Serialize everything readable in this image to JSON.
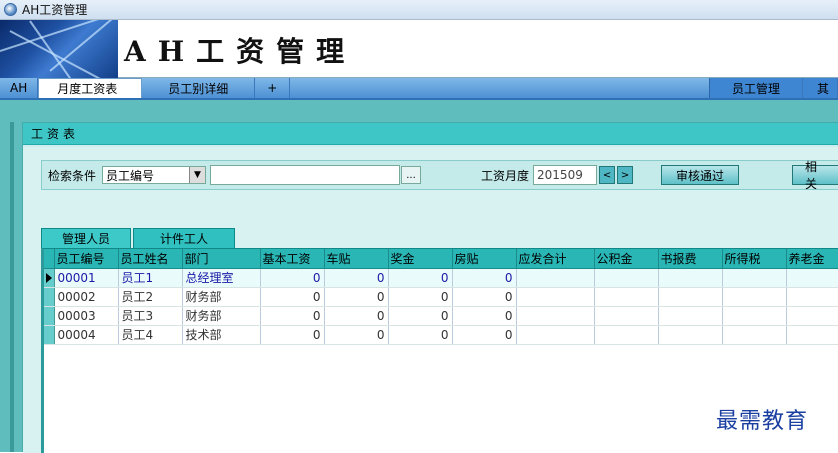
{
  "window": {
    "title": "AH工资管理"
  },
  "banner": {
    "title": "AH工资管理"
  },
  "menubar": {
    "tabs": [
      "AH",
      "月度工资表",
      "员工别详细",
      "+"
    ],
    "right_tabs": [
      "员工管理",
      "其"
    ]
  },
  "panel": {
    "header": "工资表"
  },
  "search": {
    "label": "检索条件",
    "field_value": "员工编号",
    "text_value": "",
    "dots_label": "...",
    "month_label": "工资月度",
    "month_value": "201509",
    "prev_label": "<",
    "next_label": ">",
    "approve_label": "审核通过",
    "related_label": "相关"
  },
  "subtabs": [
    "管理人员",
    "计件工人"
  ],
  "table": {
    "columns": [
      "员工编号",
      "员工姓名",
      "部门",
      "基本工资",
      "车贴",
      "奖金",
      "房贴",
      "应发合计",
      "公积金",
      "书报费",
      "所得税",
      "养老金"
    ],
    "rows": [
      {
        "id": "00001",
        "name": "员工1",
        "dept": "总经理室",
        "base": "0",
        "car": "0",
        "bonus": "0",
        "house": "0"
      },
      {
        "id": "00002",
        "name": "员工2",
        "dept": "财务部",
        "base": "0",
        "car": "0",
        "bonus": "0",
        "house": "0"
      },
      {
        "id": "00003",
        "name": "员工3",
        "dept": "财务部",
        "base": "0",
        "car": "0",
        "bonus": "0",
        "house": "0"
      },
      {
        "id": "00004",
        "name": "员工4",
        "dept": "技术部",
        "base": "0",
        "car": "0",
        "bonus": "0",
        "house": "0"
      }
    ]
  },
  "watermark": "最需教育"
}
